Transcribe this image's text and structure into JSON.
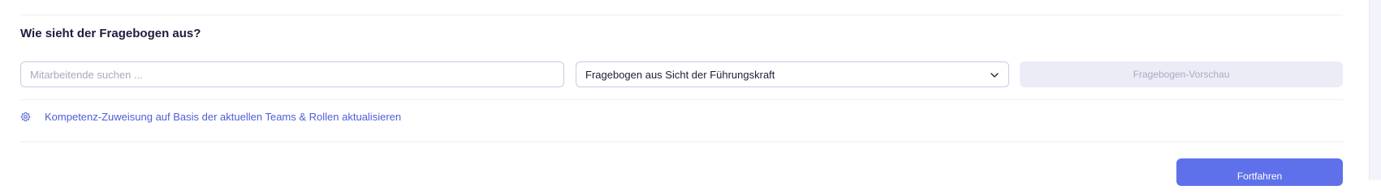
{
  "section": {
    "title": "Wie sieht der Fragebogen aus?"
  },
  "search": {
    "placeholder": "Mitarbeitende suchen ...",
    "value": ""
  },
  "perspective_select": {
    "selected": "Fragebogen aus Sicht der Führungskraft",
    "icon": "chevron-down-icon"
  },
  "preview_button": {
    "label": "Fragebogen-Vorschau",
    "disabled": true
  },
  "update_link": {
    "label": "Kompetenz-Zuweisung auf Basis der aktuellen Teams & Rollen aktualisieren",
    "icon": "gear-icon"
  },
  "footer": {
    "continue_label": "Fortfahren"
  },
  "colors": {
    "accent": "#5f71ea",
    "link": "#4d5fd6",
    "title": "#1e1c3c",
    "disabled_bg": "#ececf6"
  }
}
